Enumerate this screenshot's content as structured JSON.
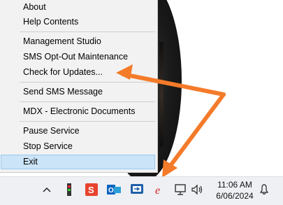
{
  "menu": {
    "items": [
      {
        "label": "About"
      },
      {
        "label": "Help Contents"
      },
      {
        "label": "Management Studio"
      },
      {
        "label": "SMS Opt-Out Maintenance"
      },
      {
        "label": "Check for Updates..."
      },
      {
        "label": "Send SMS Message"
      },
      {
        "label": "MDX - Electronic Documents"
      },
      {
        "label": "Pause Service"
      },
      {
        "label": "Stop Service"
      },
      {
        "label": "Exit"
      }
    ],
    "selected": "Exit"
  },
  "taskbar": {
    "time": "11:06 AM",
    "date": "6/06/2024",
    "tray_icons": [
      "chevron-up-icon",
      "usb-drive-icon",
      "app-s-icon",
      "outlook-icon",
      "remote-desktop-icon",
      "e-app-icon",
      "network-icon",
      "speaker-icon",
      "notification-bell-icon"
    ]
  },
  "colors": {
    "menu_bg": "#f2f2f2",
    "selected_bg": "#cce4f7",
    "arrow": "#f47b2a",
    "taskbar_bg": "#eef0f3"
  }
}
